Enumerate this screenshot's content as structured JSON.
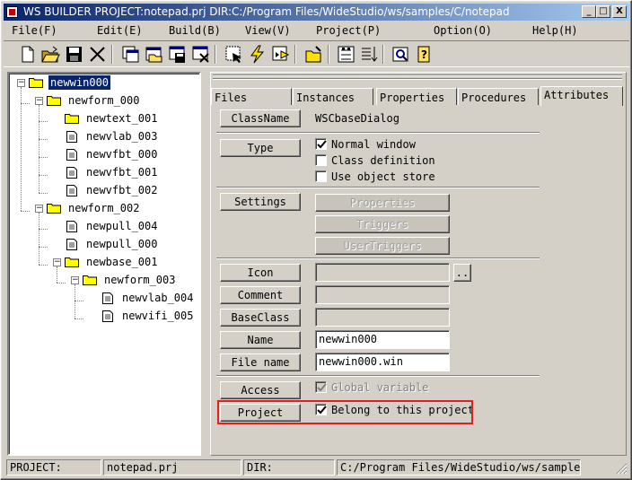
{
  "window": {
    "title": "WS BUILDER PROJECT:notepad.prj DIR:C:/Program Files/WideStudio/ws/samples/C/notepad",
    "minimize": "_",
    "maximize": "□",
    "close": "X"
  },
  "menu": [
    "File(F)",
    "Edit(E)",
    "Build(B)",
    "View(V)",
    "Project(P)",
    "Option(O)",
    "Help(H)"
  ],
  "toolbar": {
    "icons": [
      "new-document-icon",
      "open-folder-icon",
      "save-disk-icon",
      "cut-icon",
      "new-window-icon",
      "open-window-icon",
      "save-window-icon",
      "close-window-icon",
      "select-tool-icon",
      "build-icon",
      "run-icon",
      "open-file-icon",
      "grid-icon",
      "align-icon",
      "search-icon",
      "help-icon"
    ]
  },
  "tree": {
    "nodes": [
      {
        "label": "newwin000",
        "type": "folder",
        "level": 0,
        "expander": "-",
        "selected": true
      },
      {
        "label": "newform_000",
        "type": "folder",
        "level": 1,
        "expander": "-"
      },
      {
        "label": "newtext_001",
        "type": "folder",
        "level": 2
      },
      {
        "label": "newvlab_003",
        "type": "doc",
        "level": 2
      },
      {
        "label": "newvfbt_000",
        "type": "doc",
        "level": 2
      },
      {
        "label": "newvfbt_001",
        "type": "doc",
        "level": 2
      },
      {
        "label": "newvfbt_002",
        "type": "doc",
        "level": 2
      },
      {
        "label": "newform_002",
        "type": "folder",
        "level": 1,
        "expander": "-"
      },
      {
        "label": "newpull_004",
        "type": "doc",
        "level": 2
      },
      {
        "label": "newpull_000",
        "type": "doc",
        "level": 2
      },
      {
        "label": "newbase_001",
        "type": "folder",
        "level": 2,
        "expander": "-"
      },
      {
        "label": "newform_003",
        "type": "folder",
        "level": 3,
        "expander": "-"
      },
      {
        "label": "newvlab_004",
        "type": "doc",
        "level": 4
      },
      {
        "label": "newvifi_005",
        "type": "doc",
        "level": 4
      }
    ]
  },
  "tabs": [
    "Files",
    "Instances",
    "Properties",
    "Procedures",
    "Attributes"
  ],
  "active_tab": "Attributes",
  "attributes": {
    "classname_button": "ClassName",
    "classname_value": "WSCbaseDialog",
    "type_button": "Type",
    "type_options": [
      {
        "label": "Normal window",
        "checked": true
      },
      {
        "label": "Class definition",
        "checked": false
      },
      {
        "label": "Use object store",
        "checked": false
      }
    ],
    "settings_button": "Settings",
    "properties_button": "Properties",
    "triggers_button": "Triggers",
    "usertriggers_button": "UserTriggers",
    "icon_button": "Icon",
    "icon_value": "",
    "browse_button": "..",
    "comment_button": "Comment",
    "comment_value": "",
    "baseclass_button": "BaseClass",
    "baseclass_value": "",
    "name_button": "Name",
    "name_value": "newwin000",
    "filename_button": "File name",
    "filename_value": "newwin000.win",
    "access_button": "Access",
    "access_label": "Global variable",
    "access_checked": true,
    "project_button": "Project",
    "project_label": "Belong to this project",
    "project_checked": true,
    "highlight_color": "#e02020"
  },
  "status": {
    "project_label": "PROJECT:",
    "project_value": "notepad.prj",
    "dir_label": "DIR:",
    "dir_value": "C:/Program Files/WideStudio/ws/samples/C/notepad"
  },
  "colors": {
    "face": "#d4d0c8",
    "title_start": "#0a246a",
    "title_end": "#a6caf0",
    "selection": "#0a246a",
    "folder": "#ffff00"
  }
}
